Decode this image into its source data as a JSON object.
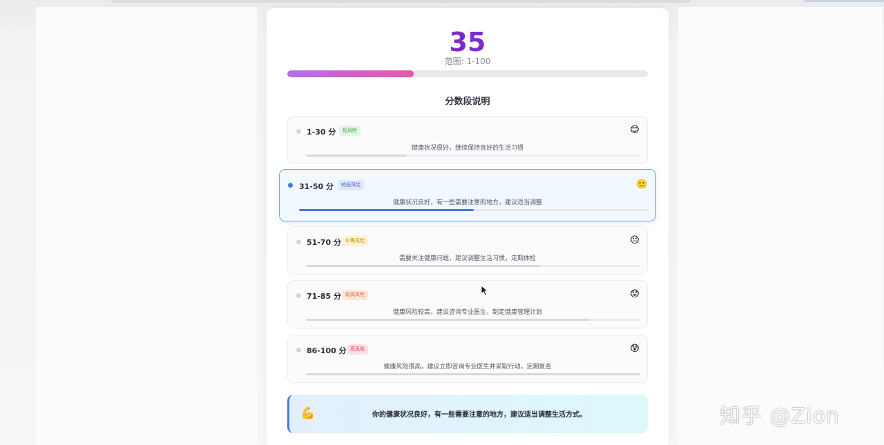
{
  "score": {
    "value": "35",
    "range_label": "范围: 1-100",
    "progress": 0.35,
    "color": "#7f2ad0"
  },
  "section_title": "分数段说明",
  "bands": [
    {
      "label": "1-30 分",
      "badge": "低风险",
      "badge_bg": "#e2f6e7",
      "badge_color": "#2f9a4f",
      "emoji": "😊",
      "desc": "健康状况很好，继续保持良好的生活习惯",
      "fill": 0.3,
      "active": false
    },
    {
      "label": "31-50 分",
      "badge": "较低风险",
      "badge_bg": "#e1e8fb",
      "badge_color": "#3b62c9",
      "emoji": "🙂",
      "desc": "健康状况良好，有一些需要注意的地方，建议适当调整",
      "fill": 0.5,
      "active": true
    },
    {
      "label": "51-70 分",
      "badge": "中等风险",
      "badge_bg": "#fdf3d2",
      "badge_color": "#b8860b",
      "emoji": "😐",
      "desc": "需要关注健康问题，建议调整生活习惯，定期体检",
      "fill": 0.7,
      "active": false
    },
    {
      "label": "71-85 分",
      "badge": "较高风险",
      "badge_bg": "#fde6dc",
      "badge_color": "#d2622f",
      "emoji": "😟",
      "desc": "健康风险较高，建议咨询专业医生，制定健康管理计划",
      "fill": 0.85,
      "active": false
    },
    {
      "label": "86-100 分",
      "badge": "高风险",
      "badge_bg": "#fde0e2",
      "badge_color": "#d23a4a",
      "emoji": "😰",
      "desc": "健康风险很高，建议立即咨询专业医生并采取行动，定期复查",
      "fill": 1.0,
      "active": false
    }
  ],
  "summary": {
    "emoji": "💪",
    "text": "你的健康状况良好，有一些需要注意的地方，建议适当调整生活方式。"
  },
  "watermark": "知乎 @Zion",
  "icons": {
    "cursor": "mouse-pointer-icon"
  }
}
